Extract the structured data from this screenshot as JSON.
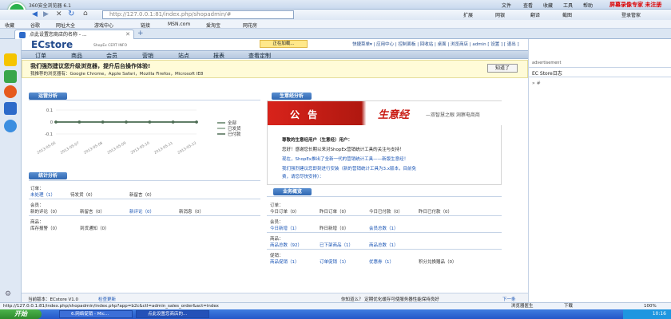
{
  "browser": {
    "title": "360安全浏览器 6.1",
    "menus": [
      "文件",
      "查看",
      "收藏",
      "工具",
      "帮助"
    ],
    "recording": "屏幕录像专家 未注册",
    "address": "http://127.0.0.1:81/index.php/shopadmin/#",
    "nav_labels": [
      "扩展",
      "网银",
      "翻译",
      "截图",
      "登录管家"
    ],
    "bookmarks": [
      "收藏",
      "谷歌",
      "网址大全",
      "游戏中心",
      "链接",
      "MSN.com",
      "爱淘宝",
      "网花房"
    ],
    "tab_title": "点此设置您商店的名称 - ..."
  },
  "header": {
    "brand": "ECstore",
    "subtitle": "ShopEx CERT INFO",
    "loading": "正在加载...",
    "links": "快捷菜单▾ | 应用中心 | 控制面板 | 回收站 | 桌面 | 浏览商店 | admin [ 设置 ] [ 退出 ]"
  },
  "menu": [
    "订单",
    "商品",
    "会员",
    "营销",
    "站点",
    "报表",
    "查看定制"
  ],
  "notice": {
    "title": "我们强烈建议您升级浏览器，提升后台操作体验!",
    "line": "我推荐的浏览器有：Google Chrome，Apple Safari，Mozilla Firefox，Microsoft IE8",
    "button": "知道了"
  },
  "sales": {
    "title": "运营分析",
    "legend": [
      "全部",
      "已发货",
      "已付款"
    ],
    "yticks": [
      "0.1",
      "0",
      "-0.1"
    ],
    "dates": [
      "2013-05-06",
      "2013-05-07",
      "2013-05-08",
      "2013-05-09",
      "2013-05-10",
      "2013-05-11",
      "2013-05-12"
    ]
  },
  "chart_data": {
    "type": "line",
    "x": [
      "2013-05-06",
      "2013-05-07",
      "2013-05-08",
      "2013-05-09",
      "2013-05-10",
      "2013-05-11",
      "2013-05-12"
    ],
    "series": [
      {
        "name": "全部",
        "values": [
          0,
          0,
          0,
          0,
          0,
          0,
          0
        ]
      },
      {
        "name": "已发货",
        "values": [
          0,
          0,
          0,
          0,
          0,
          0,
          0
        ]
      },
      {
        "name": "已付款",
        "values": [
          0,
          0,
          0,
          0,
          0,
          0,
          0
        ]
      }
    ],
    "ylim": [
      -0.1,
      0.1
    ],
    "legend": "right"
  },
  "stats": {
    "title": "统计分析",
    "order_label": "订单：",
    "order_items": [
      "未处理（1）",
      "待发货（0）",
      "新留言（0）"
    ],
    "member_label": "会员：",
    "member_items": [
      "新的评论（0）",
      "新留言（0）",
      "新评论（0）",
      "新消息（0）"
    ],
    "goods_label": "商品：",
    "goods_items": [
      "库存报警（0）",
      "到货通知（0）"
    ]
  },
  "ad": {
    "title": "生意经分析",
    "banner": "公 告",
    "brand": "生意经",
    "slogan": "—双智慧之眼 洞察电商商",
    "greeting": "尊敬的生意经用户（生意经）用户：",
    "lines": [
      "您好！感谢您长期以来对ShopEx营销统计工具的关注与支持！",
      "现在，ShopEx推出了全新一代的营销统计工具——新版生意经！",
      "我们强烈建议您即刻进行安装（新的营销统计工具为3.x版本，目前免",
      "费，请您尽快安排）："
    ]
  },
  "biz": {
    "title": "业务概览",
    "order_label": "订单：",
    "order_items": [
      "今日订单（0）",
      "昨日订单（0）",
      "今日已付款（0）",
      "昨日已付款（0）"
    ],
    "member_label": "会员：",
    "member_items": [
      "今日新增（1）",
      "昨日新增（0）",
      "会员总数（1）"
    ],
    "goods_label": "商品：",
    "goods_items": [
      "商品总数（92）",
      "已下架商品（1）",
      "商品总数（1）"
    ],
    "promo_label": "促销：",
    "promo_items": [
      "商品促销（1）",
      "订单促销（1）",
      "优惠券（1）",
      "积分兑换赠品（0）"
    ]
  },
  "right_panel": {
    "title": "advertisement",
    "item": "EC Store日志",
    "expand": "» #"
  },
  "footer": {
    "version": "当前版本：ECstore V1.0",
    "update": "检查更新",
    "tip": "你知道么？  定期优化缓存可使服务器性能保持良好",
    "next": "下一条"
  },
  "statusbar": {
    "url": "http://127.0.0.1:81/index.php/shopadmin/index.php?app=b2c&ctl=admin_sales_order&act=index",
    "doctor": "浏览器医生",
    "download": "下载",
    "zoom": "100%"
  },
  "taskbar": {
    "start": "开始",
    "tasks": [
      "6.网络促销 - Mic...",
      "点此设置您商店的..."
    ],
    "clock": "10:16"
  }
}
